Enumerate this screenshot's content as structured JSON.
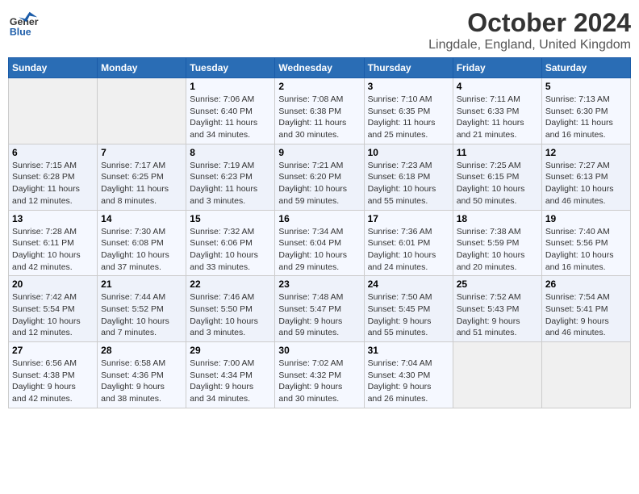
{
  "header": {
    "logo_general": "General",
    "logo_blue": "Blue",
    "title": "October 2024",
    "subtitle": "Lingdale, England, United Kingdom"
  },
  "columns": [
    "Sunday",
    "Monday",
    "Tuesday",
    "Wednesday",
    "Thursday",
    "Friday",
    "Saturday"
  ],
  "weeks": [
    [
      {
        "day": "",
        "info": ""
      },
      {
        "day": "",
        "info": ""
      },
      {
        "day": "1",
        "info": "Sunrise: 7:06 AM\nSunset: 6:40 PM\nDaylight: 11 hours\nand 34 minutes."
      },
      {
        "day": "2",
        "info": "Sunrise: 7:08 AM\nSunset: 6:38 PM\nDaylight: 11 hours\nand 30 minutes."
      },
      {
        "day": "3",
        "info": "Sunrise: 7:10 AM\nSunset: 6:35 PM\nDaylight: 11 hours\nand 25 minutes."
      },
      {
        "day": "4",
        "info": "Sunrise: 7:11 AM\nSunset: 6:33 PM\nDaylight: 11 hours\nand 21 minutes."
      },
      {
        "day": "5",
        "info": "Sunrise: 7:13 AM\nSunset: 6:30 PM\nDaylight: 11 hours\nand 16 minutes."
      }
    ],
    [
      {
        "day": "6",
        "info": "Sunrise: 7:15 AM\nSunset: 6:28 PM\nDaylight: 11 hours\nand 12 minutes."
      },
      {
        "day": "7",
        "info": "Sunrise: 7:17 AM\nSunset: 6:25 PM\nDaylight: 11 hours\nand 8 minutes."
      },
      {
        "day": "8",
        "info": "Sunrise: 7:19 AM\nSunset: 6:23 PM\nDaylight: 11 hours\nand 3 minutes."
      },
      {
        "day": "9",
        "info": "Sunrise: 7:21 AM\nSunset: 6:20 PM\nDaylight: 10 hours\nand 59 minutes."
      },
      {
        "day": "10",
        "info": "Sunrise: 7:23 AM\nSunset: 6:18 PM\nDaylight: 10 hours\nand 55 minutes."
      },
      {
        "day": "11",
        "info": "Sunrise: 7:25 AM\nSunset: 6:15 PM\nDaylight: 10 hours\nand 50 minutes."
      },
      {
        "day": "12",
        "info": "Sunrise: 7:27 AM\nSunset: 6:13 PM\nDaylight: 10 hours\nand 46 minutes."
      }
    ],
    [
      {
        "day": "13",
        "info": "Sunrise: 7:28 AM\nSunset: 6:11 PM\nDaylight: 10 hours\nand 42 minutes."
      },
      {
        "day": "14",
        "info": "Sunrise: 7:30 AM\nSunset: 6:08 PM\nDaylight: 10 hours\nand 37 minutes."
      },
      {
        "day": "15",
        "info": "Sunrise: 7:32 AM\nSunset: 6:06 PM\nDaylight: 10 hours\nand 33 minutes."
      },
      {
        "day": "16",
        "info": "Sunrise: 7:34 AM\nSunset: 6:04 PM\nDaylight: 10 hours\nand 29 minutes."
      },
      {
        "day": "17",
        "info": "Sunrise: 7:36 AM\nSunset: 6:01 PM\nDaylight: 10 hours\nand 24 minutes."
      },
      {
        "day": "18",
        "info": "Sunrise: 7:38 AM\nSunset: 5:59 PM\nDaylight: 10 hours\nand 20 minutes."
      },
      {
        "day": "19",
        "info": "Sunrise: 7:40 AM\nSunset: 5:56 PM\nDaylight: 10 hours\nand 16 minutes."
      }
    ],
    [
      {
        "day": "20",
        "info": "Sunrise: 7:42 AM\nSunset: 5:54 PM\nDaylight: 10 hours\nand 12 minutes."
      },
      {
        "day": "21",
        "info": "Sunrise: 7:44 AM\nSunset: 5:52 PM\nDaylight: 10 hours\nand 7 minutes."
      },
      {
        "day": "22",
        "info": "Sunrise: 7:46 AM\nSunset: 5:50 PM\nDaylight: 10 hours\nand 3 minutes."
      },
      {
        "day": "23",
        "info": "Sunrise: 7:48 AM\nSunset: 5:47 PM\nDaylight: 9 hours\nand 59 minutes."
      },
      {
        "day": "24",
        "info": "Sunrise: 7:50 AM\nSunset: 5:45 PM\nDaylight: 9 hours\nand 55 minutes."
      },
      {
        "day": "25",
        "info": "Sunrise: 7:52 AM\nSunset: 5:43 PM\nDaylight: 9 hours\nand 51 minutes."
      },
      {
        "day": "26",
        "info": "Sunrise: 7:54 AM\nSunset: 5:41 PM\nDaylight: 9 hours\nand 46 minutes."
      }
    ],
    [
      {
        "day": "27",
        "info": "Sunrise: 6:56 AM\nSunset: 4:38 PM\nDaylight: 9 hours\nand 42 minutes."
      },
      {
        "day": "28",
        "info": "Sunrise: 6:58 AM\nSunset: 4:36 PM\nDaylight: 9 hours\nand 38 minutes."
      },
      {
        "day": "29",
        "info": "Sunrise: 7:00 AM\nSunset: 4:34 PM\nDaylight: 9 hours\nand 34 minutes."
      },
      {
        "day": "30",
        "info": "Sunrise: 7:02 AM\nSunset: 4:32 PM\nDaylight: 9 hours\nand 30 minutes."
      },
      {
        "day": "31",
        "info": "Sunrise: 7:04 AM\nSunset: 4:30 PM\nDaylight: 9 hours\nand 26 minutes."
      },
      {
        "day": "",
        "info": ""
      },
      {
        "day": "",
        "info": ""
      }
    ]
  ]
}
